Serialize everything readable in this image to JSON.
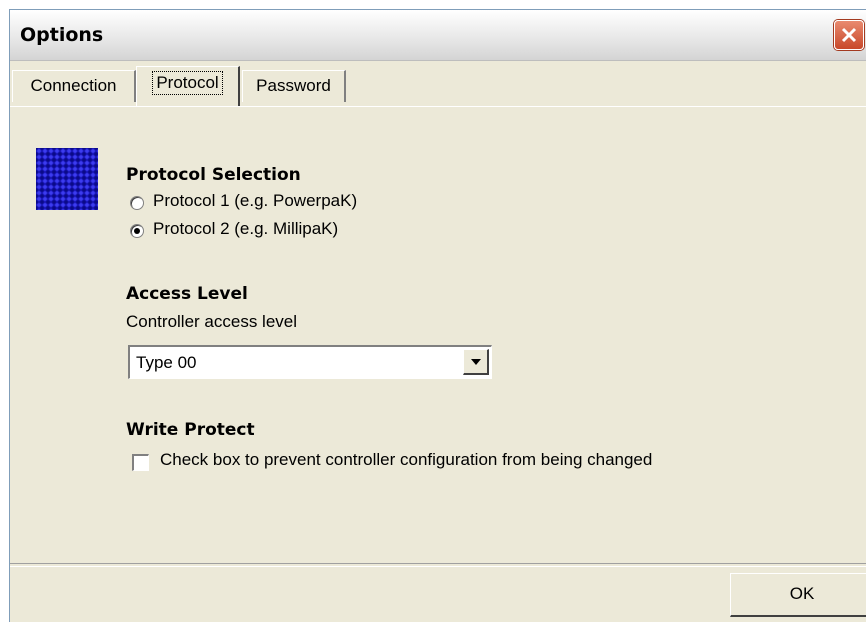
{
  "window": {
    "title": "Options"
  },
  "tabs": [
    {
      "label": "Connection"
    },
    {
      "label": "Protocol",
      "active": true
    },
    {
      "label": "Password"
    }
  ],
  "protocol_selection": {
    "heading": "Protocol Selection",
    "options": [
      {
        "label": "Protocol 1 (e.g. PowerpaK)",
        "selected": false
      },
      {
        "label": "Protocol 2 (e.g. MillipaK)",
        "selected": true
      }
    ]
  },
  "access_level": {
    "heading": "Access Level",
    "field_label": "Controller access level",
    "selected_value": "Type 00"
  },
  "write_protect": {
    "heading": "Write Protect",
    "checkbox_label": "Check box to prevent controller configuration from being changed",
    "checked": false
  },
  "buttons": {
    "ok_label": "OK"
  },
  "icons": {
    "close": "close-icon",
    "protocol": "protocol-grid-icon",
    "dropdown": "chevron-down-icon"
  },
  "colors": {
    "title_close": "#d15a3a",
    "icon_blue": "#1a18b8",
    "dialog_bg": "#ece9d8"
  }
}
